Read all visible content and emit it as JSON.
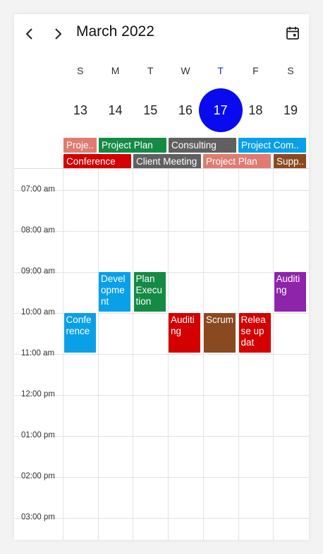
{
  "header": {
    "title": "March 2022"
  },
  "days": [
    {
      "name": "S",
      "num": "13"
    },
    {
      "name": "M",
      "num": "14"
    },
    {
      "name": "T",
      "num": "15"
    },
    {
      "name": "W",
      "num": "16"
    },
    {
      "name": "T",
      "num": "17"
    },
    {
      "name": "F",
      "num": "18"
    },
    {
      "name": "S",
      "num": "19"
    }
  ],
  "allday_events": [
    {
      "label": "Proje..",
      "color": "#e07b72"
    },
    {
      "label": "Project Plan",
      "color": "#148a45"
    },
    {
      "label": "Consulting",
      "color": "#606060"
    },
    {
      "label": "Project Com..",
      "color": "#0aa0e8"
    },
    {
      "label": "Conference",
      "color": "#d40000"
    },
    {
      "label": "Client Meeting",
      "color": "#606060"
    },
    {
      "label": "Project Plan",
      "color": "#e07b72"
    },
    {
      "label": "Supp..",
      "color": "#8a4a1f"
    }
  ],
  "time_labels": [
    "07:00 am",
    "08:00 am",
    "09:00 am",
    "10:00 am",
    "11:00 am",
    "12:00 pm",
    "01:00 pm",
    "02:00 pm",
    "03:00 pm"
  ],
  "appointments": [
    {
      "label": "Development",
      "color": "#0aa0e8"
    },
    {
      "label": "Plan Execution",
      "color": "#148a45"
    },
    {
      "label": "Auditing",
      "color": "#8e24aa"
    },
    {
      "label": "Conference",
      "color": "#0aa0e8"
    },
    {
      "label": "Auditing",
      "color": "#d40000"
    },
    {
      "label": "Scrum",
      "color": "#8a4a1f"
    },
    {
      "label": "Release updat",
      "color": "#d40000"
    }
  ]
}
